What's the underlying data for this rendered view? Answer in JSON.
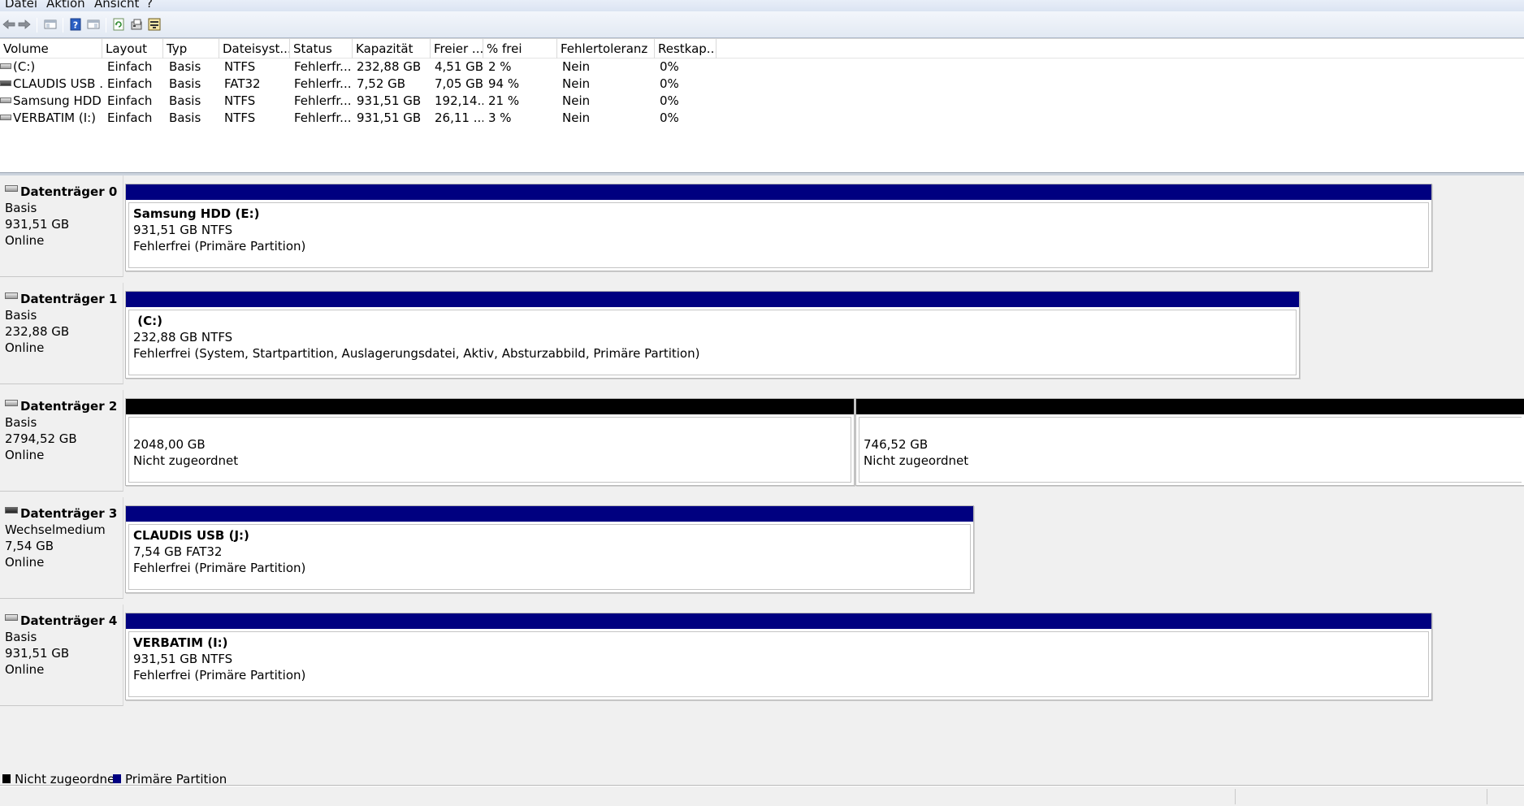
{
  "menu": [
    "Datei",
    "Aktion",
    "Ansicht",
    "?"
  ],
  "toolbar": {
    "icons": [
      "back-arrow-icon",
      "forward-arrow-icon",
      "console-tree-icon",
      "help-icon",
      "properties-view-icon",
      "refresh-icon",
      "export-icon",
      "settings-icon"
    ]
  },
  "volume_table": {
    "columns": [
      "Volume",
      "Layout",
      "Typ",
      "Dateisyst...",
      "Status",
      "Kapazität",
      "Freier ...",
      "% frei",
      "Fehlertoleranz",
      "Restkap..."
    ],
    "rows": [
      {
        "volume": "(C:)",
        "layout": "Einfach",
        "typ": "Basis",
        "fs": "NTFS",
        "status": "Fehlerfr...",
        "capacity": "232,88 GB",
        "free": "4,51 GB",
        "pct": "2 %",
        "fault": "Nein",
        "overhead": "0%"
      },
      {
        "volume": "CLAUDIS USB ...",
        "layout": "Einfach",
        "typ": "Basis",
        "fs": "FAT32",
        "status": "Fehlerfr...",
        "capacity": "7,52 GB",
        "free": "7,05 GB",
        "pct": "94 %",
        "fault": "Nein",
        "overhead": "0%"
      },
      {
        "volume": "Samsung HDD...",
        "layout": "Einfach",
        "typ": "Basis",
        "fs": "NTFS",
        "status": "Fehlerfr...",
        "capacity": "931,51 GB",
        "free": "192,14...",
        "pct": "21 %",
        "fault": "Nein",
        "overhead": "0%"
      },
      {
        "volume": "VERBATIM (I:)",
        "layout": "Einfach",
        "typ": "Basis",
        "fs": "NTFS",
        "status": "Fehlerfr...",
        "capacity": "931,51 GB",
        "free": "26,11 ...",
        "pct": "3 %",
        "fault": "Nein",
        "overhead": "0%"
      }
    ]
  },
  "disks": [
    {
      "name": "Datenträger 0",
      "type": "Basis",
      "size": "931,51 GB",
      "state": "Online",
      "partitions": [
        {
          "kind": "primary",
          "title": "Samsung HDD  (E:)",
          "line1": "931,51 GB NTFS",
          "line2": "Fehlerfrei (Primäre Partition)"
        }
      ]
    },
    {
      "name": "Datenträger 1",
      "type": "Basis",
      "size": "232,88 GB",
      "state": "Online",
      "partitions": [
        {
          "kind": "primary",
          "title": " (C:)",
          "line1": "232,88 GB NTFS",
          "line2": "Fehlerfrei (System, Startpartition, Auslagerungsdatei, Aktiv, Absturzabbild, Primäre Partition)"
        }
      ]
    },
    {
      "name": "Datenträger 2",
      "type": "Basis",
      "size": "2794,52 GB",
      "state": "Online",
      "partitions": [
        {
          "kind": "unallocated",
          "title": "",
          "line1": "2048,00 GB",
          "line2": "Nicht zugeordnet"
        },
        {
          "kind": "unallocated",
          "title": "",
          "line1": "746,52 GB",
          "line2": "Nicht zugeordnet"
        }
      ]
    },
    {
      "name": "Datenträger 3",
      "type": "Wechselmedium",
      "size": "7,54 GB",
      "state": "Online",
      "partitions": [
        {
          "kind": "primary",
          "title": "CLAUDIS USB  (J:)",
          "line1": "7,54 GB FAT32",
          "line2": "Fehlerfrei (Primäre Partition)"
        }
      ]
    },
    {
      "name": "Datenträger 4",
      "type": "Basis",
      "size": "931,51 GB",
      "state": "Online",
      "partitions": [
        {
          "kind": "primary",
          "title": "VERBATIM  (I:)",
          "line1": "931,51 GB NTFS",
          "line2": "Fehlerfrei (Primäre Partition)"
        }
      ]
    }
  ],
  "legend": {
    "unallocated": "Nicht zugeordnet",
    "primary": "Primäre Partition"
  },
  "colors": {
    "primary_partition": "#000080",
    "unallocated": "#000000",
    "disk_area_bg": "#f0f0f0"
  }
}
